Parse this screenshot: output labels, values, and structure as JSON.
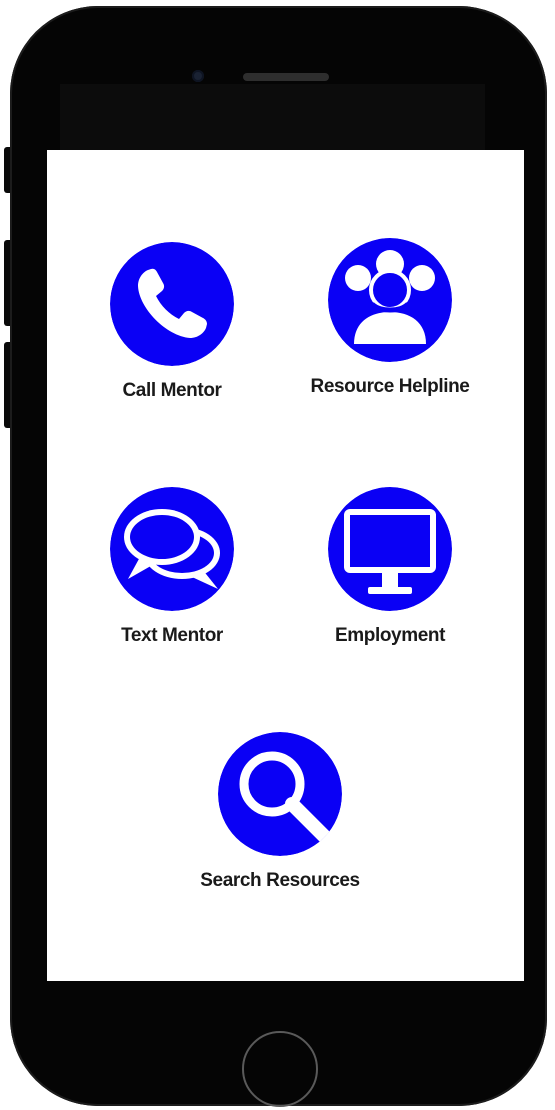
{
  "menu": {
    "call_mentor": {
      "label": "Call Mentor",
      "icon": "phone-icon"
    },
    "resource_helpline": {
      "label": "Resource Helpline",
      "icon": "people-group-icon"
    },
    "text_mentor": {
      "label": "Text Mentor",
      "icon": "chat-bubbles-icon"
    },
    "employment": {
      "label": "Employment",
      "icon": "monitor-icon"
    },
    "search_resources": {
      "label": "Search Resources",
      "icon": "magnifier-icon"
    }
  },
  "colors": {
    "icon_accent": "#0a00f5",
    "label_text": "#1a1a1a",
    "device_frame": "#050505",
    "screen_bg": "#ffffff"
  }
}
